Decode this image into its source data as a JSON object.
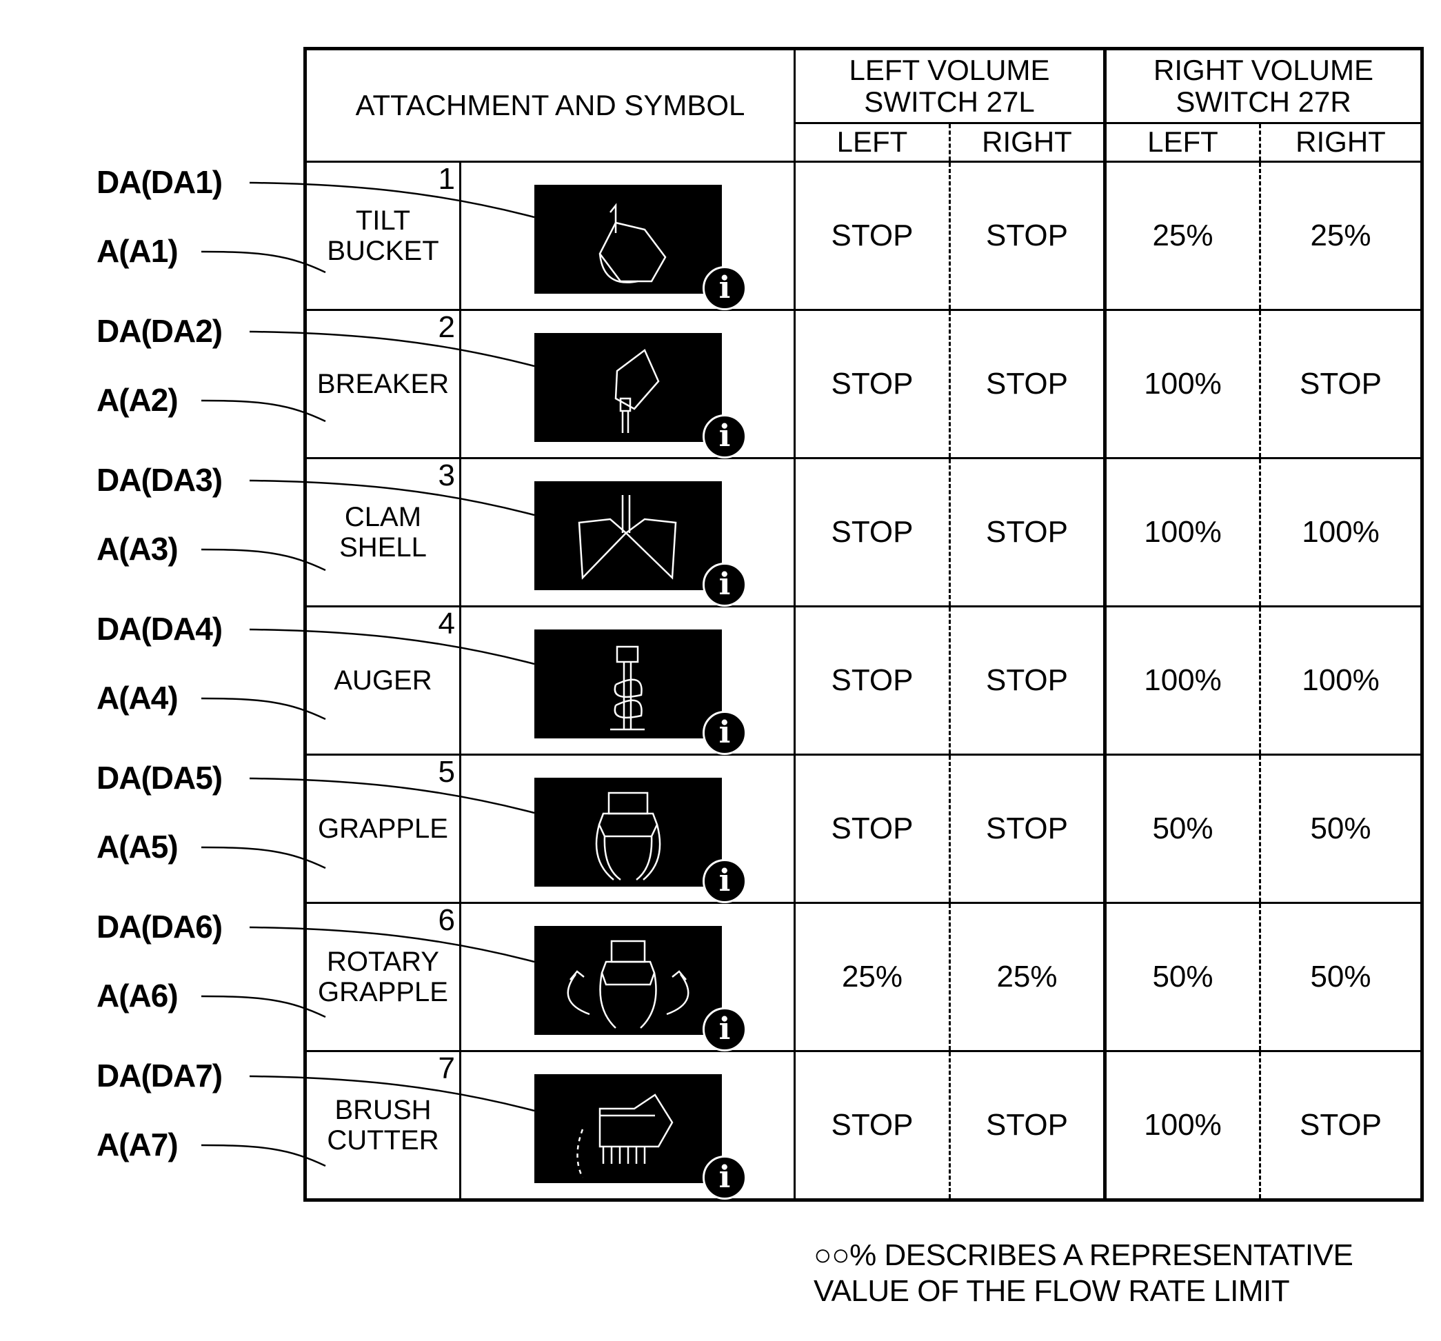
{
  "table": {
    "header": {
      "attachment_and_symbol": "ATTACHMENT AND SYMBOL",
      "left_volume_switch": [
        "LEFT VOLUME",
        "SWITCH 27L"
      ],
      "right_volume_switch": [
        "RIGHT VOLUME",
        "SWITCH 27R"
      ],
      "sub_left": "LEFT",
      "sub_right": "RIGHT"
    },
    "rows": [
      {
        "number": "1",
        "name": [
          "TILT",
          "BUCKET"
        ],
        "icon": "tilt-bucket-icon",
        "label_da": "DA(DA1)",
        "label_a": "A(A1)",
        "l_left": "STOP",
        "l_right": "STOP",
        "r_left": "25%",
        "r_right": "25%"
      },
      {
        "number": "2",
        "name": [
          "BREAKER"
        ],
        "icon": "breaker-icon",
        "label_da": "DA(DA2)",
        "label_a": "A(A2)",
        "l_left": "STOP",
        "l_right": "STOP",
        "r_left": "100%",
        "r_right": "STOP"
      },
      {
        "number": "3",
        "name": [
          "CLAM",
          "SHELL"
        ],
        "icon": "clam-shell-icon",
        "label_da": "DA(DA3)",
        "label_a": "A(A3)",
        "l_left": "STOP",
        "l_right": "STOP",
        "r_left": "100%",
        "r_right": "100%"
      },
      {
        "number": "4",
        "name": [
          "AUGER"
        ],
        "icon": "auger-icon",
        "label_da": "DA(DA4)",
        "label_a": "A(A4)",
        "l_left": "STOP",
        "l_right": "STOP",
        "r_left": "100%",
        "r_right": "100%"
      },
      {
        "number": "5",
        "name": [
          "GRAPPLE"
        ],
        "icon": "grapple-icon",
        "label_da": "DA(DA5)",
        "label_a": "A(A5)",
        "l_left": "STOP",
        "l_right": "STOP",
        "r_left": "50%",
        "r_right": "50%"
      },
      {
        "number": "6",
        "name": [
          "ROTARY",
          "GRAPPLE"
        ],
        "icon": "rotary-grapple-icon",
        "label_da": "DA(DA6)",
        "label_a": "A(A6)",
        "l_left": "25%",
        "l_right": "25%",
        "r_left": "50%",
        "r_right": "50%"
      },
      {
        "number": "7",
        "name": [
          "BRUSH",
          "CUTTER"
        ],
        "icon": "brush-cutter-icon",
        "label_da": "DA(DA7)",
        "label_a": "A(A7)",
        "l_left": "STOP",
        "l_right": "STOP",
        "r_left": "100%",
        "r_right": "STOP"
      }
    ],
    "info_badge": "i"
  },
  "footnote": [
    "○○% DESCRIBES A REPRESENTATIVE",
    "VALUE OF THE FLOW RATE LIMIT"
  ]
}
